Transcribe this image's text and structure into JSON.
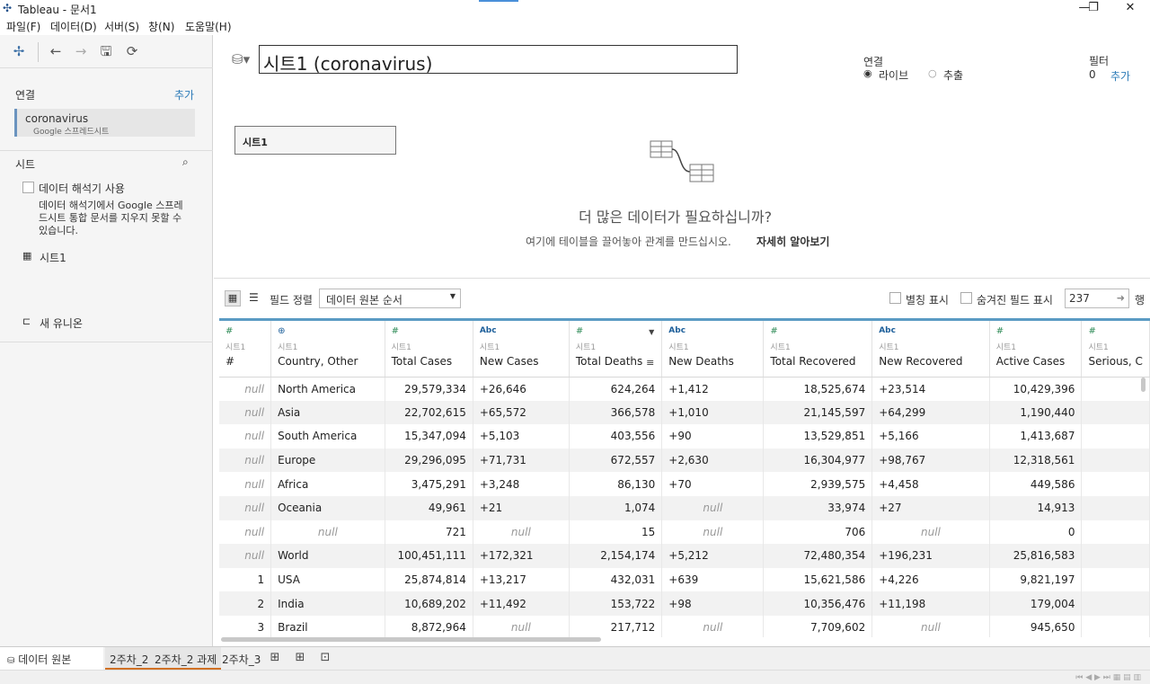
{
  "window": {
    "title": "Tableau - 문서1",
    "minimize": "—",
    "restore": "❐",
    "close": "✕"
  },
  "menu": [
    "파일(F)",
    "데이터(D)",
    "서버(S)",
    "창(N)",
    "도움말(H)"
  ],
  "toolbar": {
    "logo": "✢",
    "back": "←",
    "forward": "→",
    "save": "🖫",
    "refresh": "⟳"
  },
  "left": {
    "connections_label": "연결",
    "add_label": "추가",
    "connection_name": "coronavirus",
    "connection_type": "Google 스프레드시트",
    "sheets_label": "시트",
    "interpreter_label": "데이터 해석기 사용",
    "interpreter_note": "데이터 해석기에서 Google 스프레드시트 통합 문서를 지우지 못할 수 있습니다.",
    "sheet_item": "시트1",
    "new_union": "새 유니온"
  },
  "canvas": {
    "datasource_name": "시트1 (coronavirus)",
    "connection_label": "연결",
    "live_label": "라이브",
    "extract_label": "추출",
    "filter_label": "필터",
    "filter_count": "0",
    "filter_add": "추가",
    "sheet_box": "시트1",
    "more_data_title": "더 많은 데이터가 필요하십니까?",
    "more_data_text": "여기에 테이블을 끌어놓아 관계를 만드십시오.",
    "learn_more": "자세히 알아보기"
  },
  "grid_toolbar": {
    "sort_label": "필드 정렬",
    "sort_value": "데이터 원본 순서",
    "alias_label": "별칭 표시",
    "hidden_label": "숨겨진 필드 표시",
    "rows_value": "237",
    "rows_label": "행"
  },
  "table": {
    "source": "시트1",
    "columns": [
      {
        "type": "#",
        "name": "#"
      },
      {
        "type": "⊕",
        "name": "Country, Other"
      },
      {
        "type": "#",
        "name": "Total Cases"
      },
      {
        "type": "Abc",
        "name": "New Cases"
      },
      {
        "type": "#",
        "name": "Total Deaths"
      },
      {
        "type": "Abc",
        "name": "New Deaths"
      },
      {
        "type": "#",
        "name": "Total Recovered"
      },
      {
        "type": "Abc",
        "name": "New Recovered"
      },
      {
        "type": "#",
        "name": "Active Cases"
      },
      {
        "type": "#",
        "name": "Serious, C"
      }
    ],
    "rows": [
      [
        "null",
        "North America",
        "29,579,334",
        "+26,646",
        "624,264",
        "+1,412",
        "18,525,674",
        "+23,514",
        "10,429,396",
        ""
      ],
      [
        "null",
        "Asia",
        "22,702,615",
        "+65,572",
        "366,578",
        "+1,010",
        "21,145,597",
        "+64,299",
        "1,190,440",
        ""
      ],
      [
        "null",
        "South America",
        "15,347,094",
        "+5,103",
        "403,556",
        "+90",
        "13,529,851",
        "+5,166",
        "1,413,687",
        ""
      ],
      [
        "null",
        "Europe",
        "29,296,095",
        "+71,731",
        "672,557",
        "+2,630",
        "16,304,977",
        "+98,767",
        "12,318,561",
        ""
      ],
      [
        "null",
        "Africa",
        "3,475,291",
        "+3,248",
        "86,130",
        "+70",
        "2,939,575",
        "+4,458",
        "449,586",
        ""
      ],
      [
        "null",
        "Oceania",
        "49,961",
        "+21",
        "1,074",
        "null",
        "33,974",
        "+27",
        "14,913",
        ""
      ],
      [
        "null",
        "null",
        "721",
        "null",
        "15",
        "null",
        "706",
        "null",
        "0",
        ""
      ],
      [
        "null",
        "World",
        "100,451,111",
        "+172,321",
        "2,154,174",
        "+5,212",
        "72,480,354",
        "+196,231",
        "25,816,583",
        ""
      ],
      [
        "1",
        "USA",
        "25,874,814",
        "+13,217",
        "432,031",
        "+639",
        "15,621,586",
        "+4,226",
        "9,821,197",
        ""
      ],
      [
        "2",
        "India",
        "10,689,202",
        "+11,492",
        "153,722",
        "+98",
        "10,356,476",
        "+11,198",
        "179,004",
        ""
      ],
      [
        "3",
        "Brazil",
        "8,872,964",
        "null",
        "217,712",
        "null",
        "7,709,602",
        "null",
        "945,650",
        ""
      ]
    ]
  },
  "bottom": {
    "datasource_tab": "데이터 원본",
    "tabs": [
      "2주차_2",
      "2주차_2 과제",
      "2주차_3"
    ],
    "nav": "⏮ ◀ ▶ ⏭ ▦ ▤ ▥"
  }
}
